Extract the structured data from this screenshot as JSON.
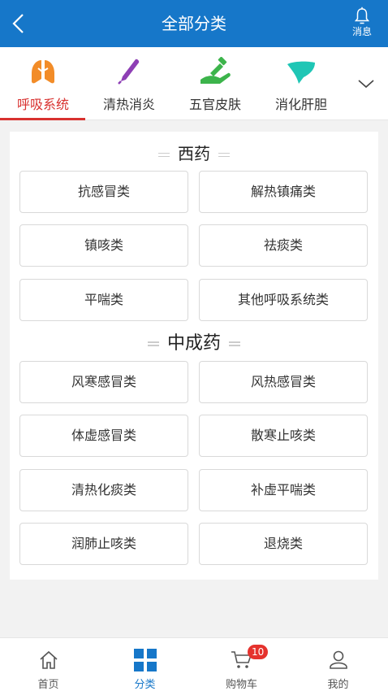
{
  "header": {
    "title": "全部分类",
    "message_label": "消息",
    "bar_color": "#1677c9"
  },
  "category_tabs": [
    {
      "label": "呼吸系统",
      "icon": "lungs-icon",
      "color": "#f28c28",
      "active": true
    },
    {
      "label": "清热消炎",
      "icon": "thermometer-icon",
      "color": "#8e3fb5",
      "active": false
    },
    {
      "label": "五官皮肤",
      "icon": "hand-care-icon",
      "color": "#3cb44b",
      "active": false
    },
    {
      "label": "消化肝胆",
      "icon": "liver-icon",
      "color": "#1fc6b5",
      "active": false
    }
  ],
  "sections": {
    "western": {
      "title": "西药",
      "items": [
        "抗感冒类",
        "解热镇痛类",
        "镇咳类",
        "祛痰类",
        "平喘类",
        "其他呼吸系统类"
      ]
    },
    "chinese": {
      "title": "中成药",
      "items": [
        "风寒感冒类",
        "风热感冒类",
        "体虚感冒类",
        "散寒止咳类",
        "清热化痰类",
        "补虚平喘类",
        "润肺止咳类",
        "退烧类"
      ]
    }
  },
  "bottom_nav": {
    "items": [
      {
        "label": "首页",
        "icon": "home-icon",
        "active": false
      },
      {
        "label": "分类",
        "icon": "category-grid-icon",
        "active": true
      },
      {
        "label": "购物车",
        "icon": "cart-icon",
        "active": false
      },
      {
        "label": "我的",
        "icon": "user-icon",
        "active": false
      }
    ],
    "cart_badge": "10"
  },
  "colors": {
    "active_tab": "#d8312f",
    "active_nav": "#1677c9",
    "badge": "#e5322d"
  }
}
